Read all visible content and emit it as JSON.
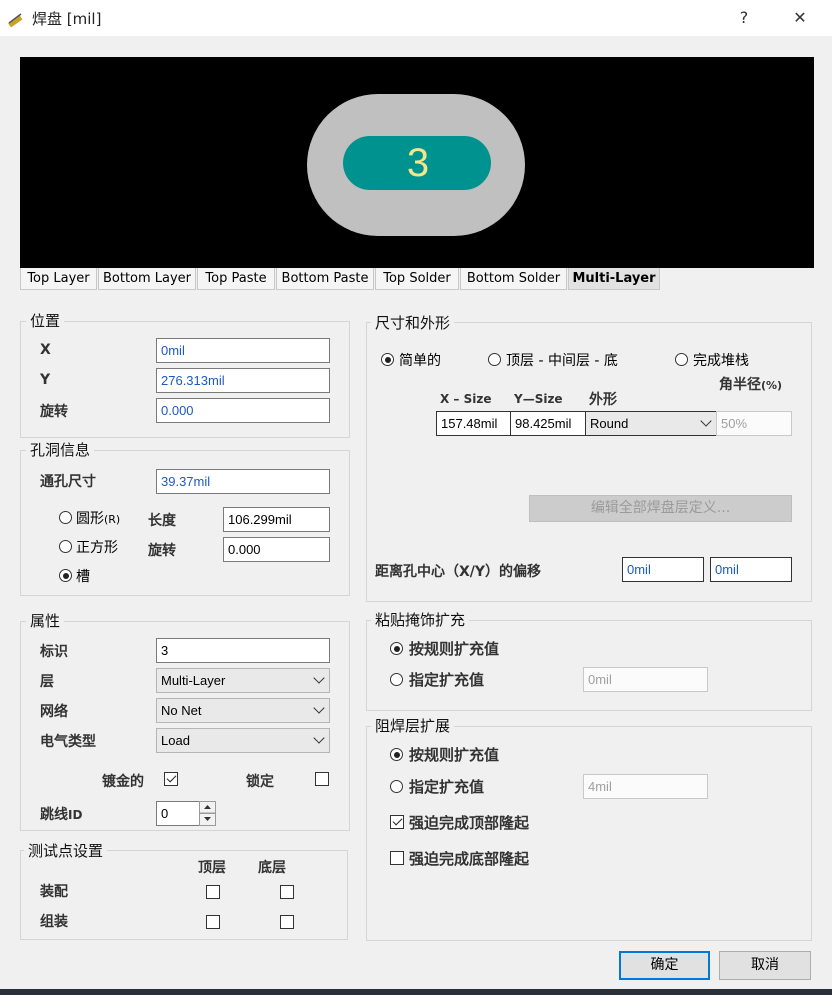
{
  "window": {
    "title": "焊盘 [mil]",
    "help": "?",
    "close": "✕"
  },
  "preview": {
    "pad_designator": "3",
    "colors": {
      "background": "#000000",
      "copper": "#c0c0c0",
      "hole": "#00928f",
      "text": "#f0e68c"
    }
  },
  "tabs": [
    "Top Layer",
    "Bottom Layer",
    "Top Paste",
    "Bottom Paste",
    "Top Solder",
    "Bottom Solder",
    "Multi-Layer"
  ],
  "active_tab": "Multi-Layer",
  "location": {
    "title": "位置",
    "x_label": "X",
    "x_value": "0mil",
    "y_label": "Y",
    "y_value": "276.313mil",
    "rot_label": "旋转",
    "rot_value": "0.000"
  },
  "hole": {
    "title": "孔洞信息",
    "size_label": "通孔尺寸",
    "size_value": "39.37mil",
    "round_label": "圆形",
    "round_hotkey": "(R)",
    "square_label": "正方形",
    "slot_label": "槽",
    "length_label": "长度",
    "length_value": "106.299mil",
    "rot_label": "旋转",
    "rot_value": "0.000"
  },
  "props": {
    "title": "属性",
    "designator_label": "标识",
    "designator_value": "3",
    "layer_label": "层",
    "layer_value": "Multi-Layer",
    "net_label": "网络",
    "net_value": "No Net",
    "etype_label": "电气类型",
    "etype_value": "Load",
    "plated_label": "镀金的",
    "locked_label": "锁定",
    "jumper_label": "跳线",
    "jumper_suffix": "ID",
    "jumper_value": "0"
  },
  "testpoint": {
    "title": "测试点设置",
    "top_label": "顶层",
    "bottom_label": "底层",
    "fab_label": "装配",
    "asm_label": "组装"
  },
  "size_shape": {
    "title": "尺寸和外形",
    "simple": "简单的",
    "tmb_label": "顶层 - 中间层 - 底",
    "full_stack": "完成堆栈",
    "radius_label": "角半径",
    "radius_unit": "(%)",
    "xsize_label": "X – Size",
    "ysize_label": "Y—Size",
    "shape_label": "外形",
    "xsize_value": "157.48mil",
    "ysize_value": "98.425mil",
    "shape_value": "Round",
    "radius_value": "50%",
    "edit_button": "编辑全部焊盘层定义...",
    "offset_label": "距离孔中心（X/Y）的偏移",
    "offset_x": "0mil",
    "offset_y": "0mil"
  },
  "paste": {
    "title": "粘贴掩饰扩充",
    "rule": "按规则扩充值",
    "specify": "指定扩充值",
    "value": "0mil"
  },
  "solder": {
    "title": "阻焊层扩展",
    "rule": "按规则扩充值",
    "specify": "指定扩充值",
    "value": "4mil",
    "force_top": "强迫完成顶部隆起",
    "force_bottom": "强迫完成底部隆起"
  },
  "buttons": {
    "ok": "确定",
    "cancel": "取消"
  }
}
